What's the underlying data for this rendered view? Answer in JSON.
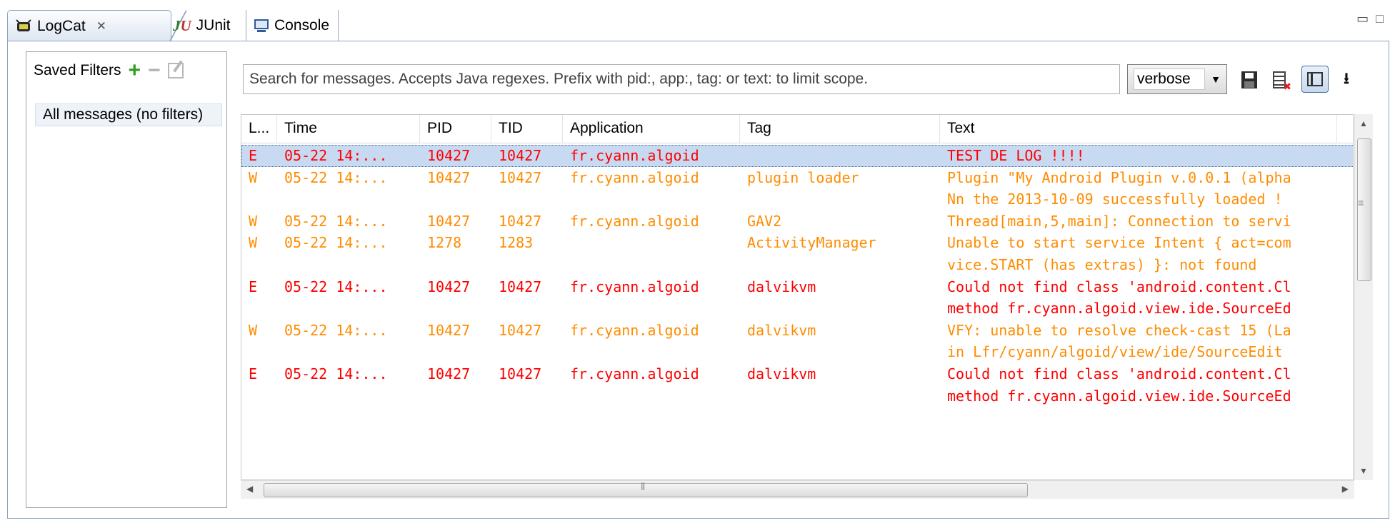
{
  "tabs": [
    {
      "label": "LogCat",
      "icon": "android-bug-icon",
      "closable": true
    },
    {
      "label": "JUnit",
      "icon": "junit-icon"
    },
    {
      "label": "Console",
      "icon": "console-icon"
    }
  ],
  "saved_filters": {
    "title": "Saved Filters",
    "items": [
      "All messages (no filters)"
    ]
  },
  "search": {
    "placeholder": "Search for messages. Accepts Java regexes. Prefix with pid:, app:, tag: or text: to limit scope."
  },
  "level_select": {
    "value": "verbose"
  },
  "table": {
    "columns": [
      "L...",
      "Time",
      "PID",
      "TID",
      "Application",
      "Tag",
      "Text"
    ],
    "rows": [
      {
        "level": "E",
        "time": "05-22 14:...",
        "pid": "10427",
        "tid": "10427",
        "app": "fr.cyann.algoid",
        "tag": "",
        "text": [
          "TEST DE LOG !!!!"
        ],
        "selected": true
      },
      {
        "level": "W",
        "time": "05-22 14:...",
        "pid": "10427",
        "tid": "10427",
        "app": "fr.cyann.algoid",
        "tag": "plugin loader",
        "text": [
          "Plugin \"My Android Plugin v.0.0.1 (alpha",
          "Nn the 2013-10-09 successfully loaded !"
        ]
      },
      {
        "level": "W",
        "time": "05-22 14:...",
        "pid": "10427",
        "tid": "10427",
        "app": "fr.cyann.algoid",
        "tag": "GAV2",
        "text": [
          "Thread[main,5,main]: Connection to servi"
        ]
      },
      {
        "level": "W",
        "time": "05-22 14:...",
        "pid": "1278",
        "tid": "1283",
        "app": "",
        "tag": "ActivityManager",
        "text": [
          "Unable to start service Intent { act=com",
          "vice.START (has extras) }: not found"
        ]
      },
      {
        "level": "E",
        "time": "05-22 14:...",
        "pid": "10427",
        "tid": "10427",
        "app": "fr.cyann.algoid",
        "tag": "dalvikvm",
        "text": [
          "Could not find class 'android.content.Cl",
          "method fr.cyann.algoid.view.ide.SourceEd"
        ]
      },
      {
        "level": "W",
        "time": "05-22 14:...",
        "pid": "10427",
        "tid": "10427",
        "app": "fr.cyann.algoid",
        "tag": "dalvikvm",
        "text": [
          "VFY: unable to resolve check-cast 15 (La",
          " in Lfr/cyann/algoid/view/ide/SourceEdit"
        ]
      },
      {
        "level": "E",
        "time": "05-22 14:...",
        "pid": "10427",
        "tid": "10427",
        "app": "fr.cyann.algoid",
        "tag": "dalvikvm",
        "text": [
          "Could not find class 'android.content.Cl",
          "method fr.cyann.algoid.view.ide.SourceEd"
        ]
      }
    ]
  },
  "colors": {
    "error": "#ff0000",
    "warning": "#ff8c00",
    "selection": "#c7daf2"
  }
}
